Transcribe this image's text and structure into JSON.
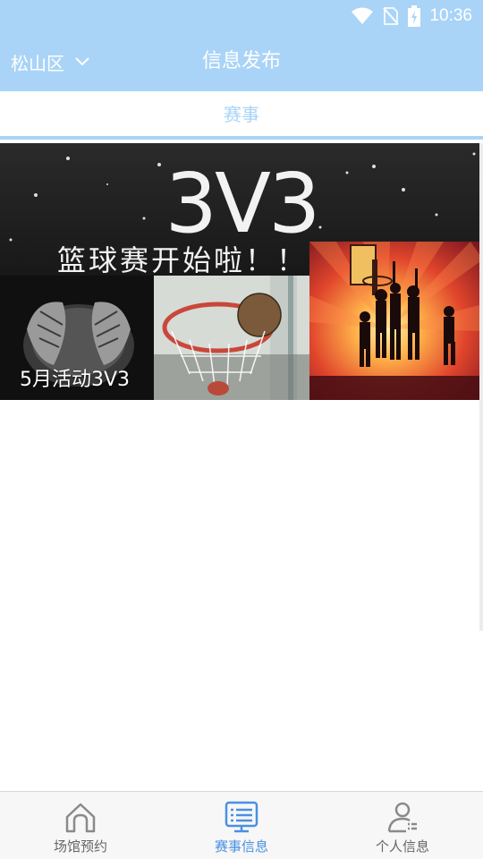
{
  "status_bar": {
    "time": "10:36",
    "icons": [
      "wifi-icon",
      "no-sim-icon",
      "battery-charging-icon"
    ]
  },
  "header": {
    "district": "松山区",
    "title": "信息发布"
  },
  "tabs": [
    {
      "label": "赛事",
      "active": true
    }
  ],
  "events": [
    {
      "name": "5月活动3V3",
      "banner_headline": "3V3",
      "banner_subtitle": "篮球赛开始啦！！！"
    }
  ],
  "bottom_nav": [
    {
      "label": "场馆预约",
      "icon": "home-icon",
      "active": false
    },
    {
      "label": "赛事信息",
      "icon": "list-monitor-icon",
      "active": true
    },
    {
      "label": "个人信息",
      "icon": "person-icon",
      "active": false
    }
  ],
  "colors": {
    "primary": "#a9d4f7",
    "nav_active": "#4a90e2",
    "nav_inactive": "#666666"
  }
}
